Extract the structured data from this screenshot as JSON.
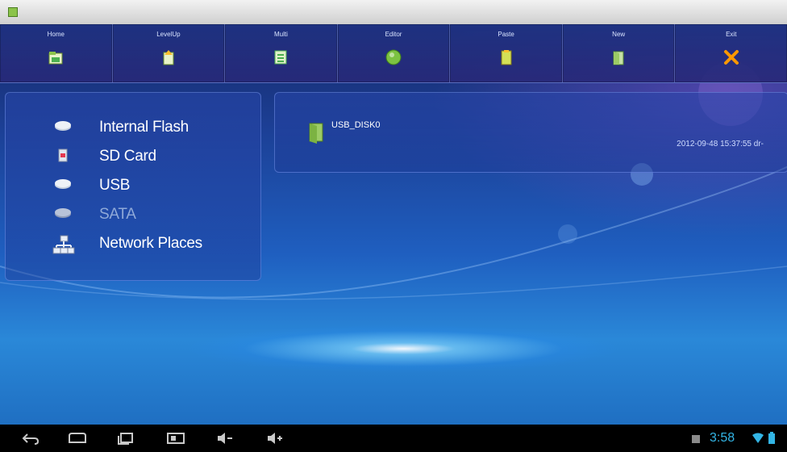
{
  "toolbar": {
    "buttons": [
      {
        "label": "Home",
        "icon": "home-icon"
      },
      {
        "label": "LevelUp",
        "icon": "level-up-icon"
      },
      {
        "label": "Multi",
        "icon": "multi-select-icon"
      },
      {
        "label": "Editor",
        "icon": "editor-icon"
      },
      {
        "label": "Paste",
        "icon": "paste-icon"
      },
      {
        "label": "New",
        "icon": "new-folder-icon"
      },
      {
        "label": "Exit",
        "icon": "exit-icon"
      }
    ]
  },
  "sidebar": {
    "items": [
      {
        "label": "Internal Flash",
        "icon": "flash-drive-icon",
        "enabled": true
      },
      {
        "label": "SD Card",
        "icon": "sd-card-icon",
        "enabled": true
      },
      {
        "label": "USB",
        "icon": "usb-drive-icon",
        "enabled": true
      },
      {
        "label": "SATA",
        "icon": "sata-drive-icon",
        "enabled": false
      },
      {
        "label": "Network Places",
        "icon": "network-icon",
        "enabled": true
      }
    ]
  },
  "files": {
    "items": [
      {
        "name": "USB_DISK0",
        "date": "2012-09-48 15:37:55 dr-",
        "icon": "folder-icon"
      }
    ]
  },
  "navbar": {
    "buttons": [
      {
        "name": "back-icon"
      },
      {
        "name": "home-icon"
      },
      {
        "name": "recent-apps-icon"
      },
      {
        "name": "screenshot-icon"
      },
      {
        "name": "volume-down-icon"
      },
      {
        "name": "volume-up-icon"
      }
    ]
  },
  "status": {
    "time": "3:58"
  },
  "colors": {
    "accent": "#33b5e5",
    "toolbar_bg": "#1e3282",
    "wallpaper_top": "#14235e",
    "wallpaper_bottom": "#2a88d8"
  }
}
